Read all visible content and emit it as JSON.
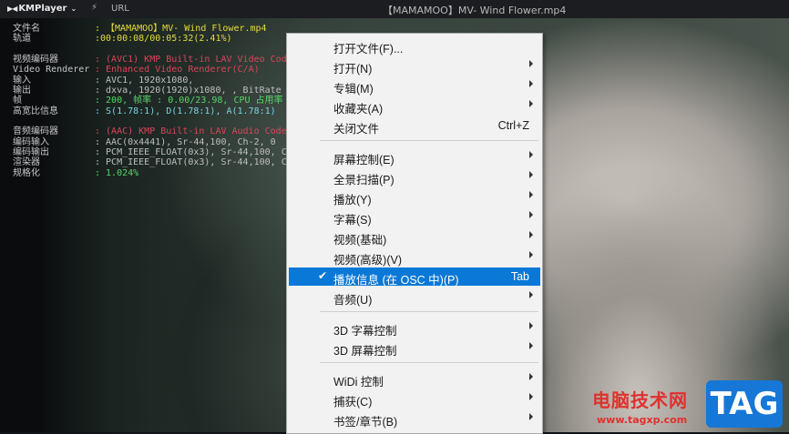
{
  "titlebar": {
    "app_name": "KMPlayer",
    "url_label": "URL",
    "window_title": "【MAMAMOO】MV- Wind Flower.mp4"
  },
  "info_panel": [
    {
      "label": "文件名",
      "value": ": 【MAMAMOO】MV- Wind Flower.mp4",
      "color": "yellow"
    },
    {
      "label": "轨道",
      "value": ":00:00:08/00:05:32(2.41%)",
      "color": "yellow"
    },
    {
      "label": "",
      "value": "",
      "color": "gap"
    },
    {
      "label": "视频编码器",
      "value": ": (AVC1) KMP Built-in LAV Video Code",
      "color": "red"
    },
    {
      "label": "Video Renderer",
      "value": ": Enhanced Video Renderer(C/A)",
      "color": "red"
    },
    {
      "label": "输入",
      "value": ": AVC1, 1920x1080,",
      "color": "grey"
    },
    {
      "label": "输出",
      "value": ": dxva, 1920(1920)x1080, , BitRate",
      "color": "grey"
    },
    {
      "label": "帧",
      "value": ": 200, 帧率 : 0.00/23.98, CPU 占用率",
      "color": "green"
    },
    {
      "label": "高宽比信息",
      "value": ": S(1.78:1), D(1.78:1), A(1.78:1)",
      "color": "cyan"
    },
    {
      "label": "",
      "value": "",
      "color": "gap"
    },
    {
      "label": "音频编码器",
      "value": ": (AAC) KMP Built-in LAV Audio Code",
      "color": "red"
    },
    {
      "label": "编码输入",
      "value": ": AAC(0x4441), Sr-44,100, Ch-2, 0",
      "color": "grey"
    },
    {
      "label": "编码输出",
      "value": ": PCM_IEEE_FLOAT(0x3), Sr-44,100, C",
      "color": "grey"
    },
    {
      "label": "渲染器",
      "value": ": PCM_IEEE_FLOAT(0x3), Sr-44,100, C",
      "color": "grey"
    },
    {
      "label": "规格化",
      "value": ": 1.024%",
      "color": "green"
    }
  ],
  "menu": {
    "items": [
      {
        "label": "打开文件(F)...",
        "accel": "",
        "submenu": false
      },
      {
        "label": "打开(N)",
        "accel": "",
        "submenu": true
      },
      {
        "label": "专辑(M)",
        "accel": "",
        "submenu": true
      },
      {
        "label": "收藏夹(A)",
        "accel": "",
        "submenu": true
      },
      {
        "label": "关闭文件",
        "accel": "Ctrl+Z",
        "submenu": false
      },
      {
        "label": "屏幕控制(E)",
        "accel": "",
        "submenu": true
      },
      {
        "label": "全景扫描(P)",
        "accel": "",
        "submenu": true
      },
      {
        "label": "播放(Y)",
        "accel": "",
        "submenu": true
      },
      {
        "label": "字幕(S)",
        "accel": "",
        "submenu": true
      },
      {
        "label": "视频(基础)",
        "accel": "",
        "submenu": true
      },
      {
        "label": "视频(高级)(V)",
        "accel": "",
        "submenu": true
      },
      {
        "label": "播放信息 (在 OSC 中)(P)",
        "accel": "Tab",
        "submenu": false,
        "checked": true,
        "highlighted": true
      },
      {
        "label": "音频(U)",
        "accel": "",
        "submenu": true
      },
      {
        "label": "3D 字幕控制",
        "accel": "",
        "submenu": true
      },
      {
        "label": "3D 屏幕控制",
        "accel": "",
        "submenu": true
      },
      {
        "label": "WiDi 控制",
        "accel": "",
        "submenu": true
      },
      {
        "label": "捕获(C)",
        "accel": "",
        "submenu": true
      },
      {
        "label": "书签/章节(B)",
        "accel": "",
        "submenu": true
      }
    ],
    "check_glyph": "✔"
  },
  "watermark": {
    "site_name": "电脑技术网",
    "site_url": "www.tagxp.com",
    "tag": "TAG"
  },
  "colors": {
    "highlight": "#0a78d7",
    "menu_bg": "#f2f2f2",
    "watermark_red": "#e0312e",
    "tag_blue": "#1677d6"
  }
}
